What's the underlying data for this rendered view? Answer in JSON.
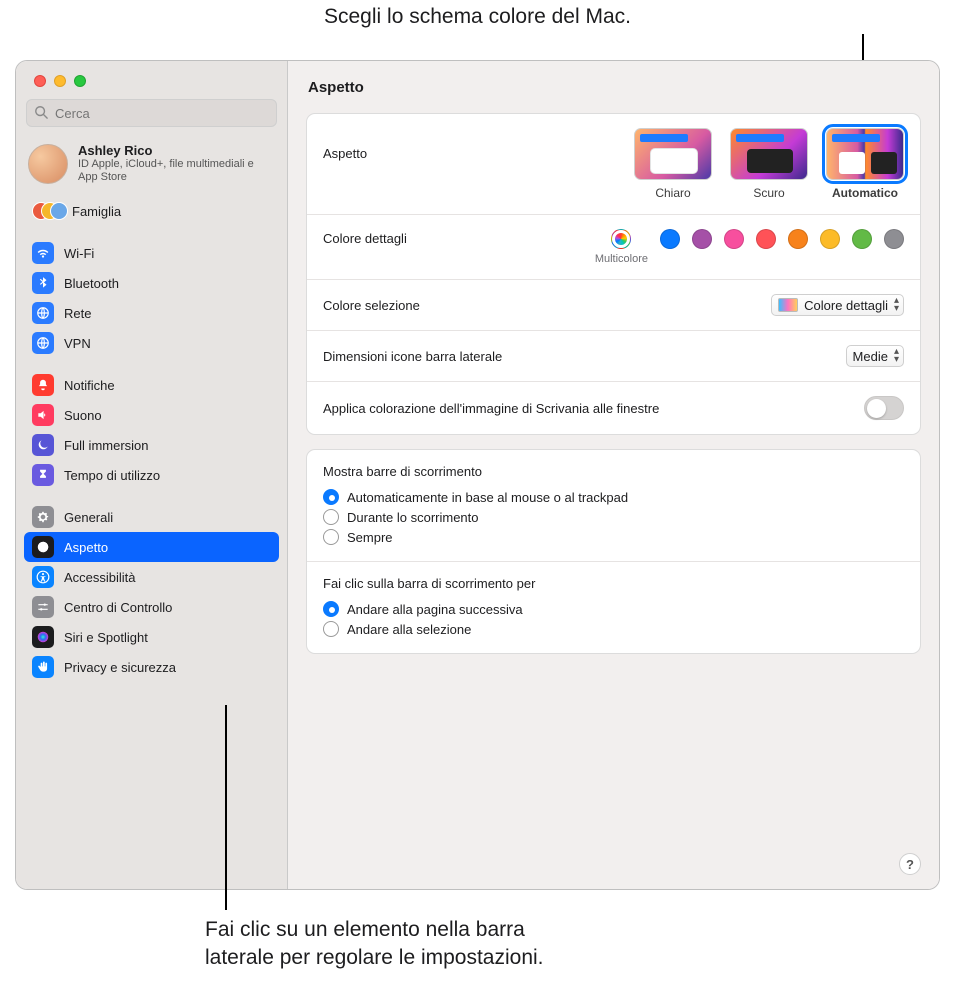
{
  "callouts": {
    "top": "Scegli lo schema colore del Mac.",
    "bottom": "Fai clic su un elemento nella barra\nlaterale per regolare le impostazioni."
  },
  "window_title": "Aspetto",
  "search": {
    "placeholder": "Cerca"
  },
  "account": {
    "name": "Ashley Rico",
    "sub": "ID Apple, iCloud+, file multimediali e App Store",
    "family": "Famiglia"
  },
  "sidebar_groups": [
    {
      "items": [
        {
          "id": "wifi",
          "label": "Wi-Fi",
          "icon": "wifi-icon",
          "bg": "#2b7bff"
        },
        {
          "id": "bluetooth",
          "label": "Bluetooth",
          "icon": "bluetooth-icon",
          "bg": "#2b7bff"
        },
        {
          "id": "rete",
          "label": "Rete",
          "icon": "globe-icon",
          "bg": "#2b7bff"
        },
        {
          "id": "vpn",
          "label": "VPN",
          "icon": "globe-icon",
          "bg": "#2b7bff"
        }
      ]
    },
    {
      "items": [
        {
          "id": "notifiche",
          "label": "Notifiche",
          "icon": "bell-icon",
          "bg": "#ff3b30"
        },
        {
          "id": "suono",
          "label": "Suono",
          "icon": "speaker-icon",
          "bg": "#ff3b60"
        },
        {
          "id": "fullimmersion",
          "label": "Full immersion",
          "icon": "moon-icon",
          "bg": "#5755d6"
        },
        {
          "id": "tempo",
          "label": "Tempo di utilizzo",
          "icon": "hourglass-icon",
          "bg": "#6a5ae0"
        }
      ]
    },
    {
      "items": [
        {
          "id": "generali",
          "label": "Generali",
          "icon": "gear-icon",
          "bg": "#8e8e93"
        },
        {
          "id": "aspetto",
          "label": "Aspetto",
          "icon": "contrast-icon",
          "bg": "#1c1c1e",
          "selected": true
        },
        {
          "id": "accessibilita",
          "label": "Accessibilità",
          "icon": "accessibility-icon",
          "bg": "#0a84ff"
        },
        {
          "id": "centrocontrollo",
          "label": "Centro di Controllo",
          "icon": "sliders-icon",
          "bg": "#8e8e93"
        },
        {
          "id": "siri",
          "label": "Siri e Spotlight",
          "icon": "siri-icon",
          "bg": "#1c1c1e"
        },
        {
          "id": "privacy",
          "label": "Privacy e sicurezza",
          "icon": "hand-icon",
          "bg": "#0a84ff"
        }
      ]
    }
  ],
  "appearance": {
    "label": "Aspetto",
    "options": [
      {
        "key": "light",
        "label": "Chiaro"
      },
      {
        "key": "dark",
        "label": "Scuro"
      },
      {
        "key": "auto",
        "label": "Automatico",
        "selected": true
      }
    ]
  },
  "accent": {
    "label": "Colore dettagli",
    "selected_label": "Multicolore",
    "swatches": [
      {
        "key": "multi",
        "color": "multi"
      },
      {
        "key": "blue",
        "color": "#0a7aff"
      },
      {
        "key": "purple",
        "color": "#a550a7"
      },
      {
        "key": "pink",
        "color": "#f74f9e"
      },
      {
        "key": "red",
        "color": "#ff5257"
      },
      {
        "key": "orange",
        "color": "#f7821b"
      },
      {
        "key": "yellow",
        "color": "#fcbb28"
      },
      {
        "key": "green",
        "color": "#62ba46"
      },
      {
        "key": "gray",
        "color": "#8e8e93"
      }
    ]
  },
  "highlight": {
    "label": "Colore selezione",
    "value": "Colore dettagli"
  },
  "sidebar_size": {
    "label": "Dimensioni icone barra laterale",
    "value": "Medie"
  },
  "wallpaper_tint": {
    "label": "Applica colorazione dell'immagine di Scrivania alle finestre",
    "on": false
  },
  "scrollbars": {
    "title": "Mostra barre di scorrimento",
    "options": [
      {
        "label": "Automaticamente in base al mouse o al trackpad",
        "checked": true
      },
      {
        "label": "Durante lo scorrimento",
        "checked": false
      },
      {
        "label": "Sempre",
        "checked": false
      }
    ]
  },
  "scrollclick": {
    "title": "Fai clic sulla barra di scorrimento per",
    "options": [
      {
        "label": "Andare alla pagina successiva",
        "checked": true
      },
      {
        "label": "Andare alla selezione",
        "checked": false
      }
    ]
  },
  "help": "?"
}
